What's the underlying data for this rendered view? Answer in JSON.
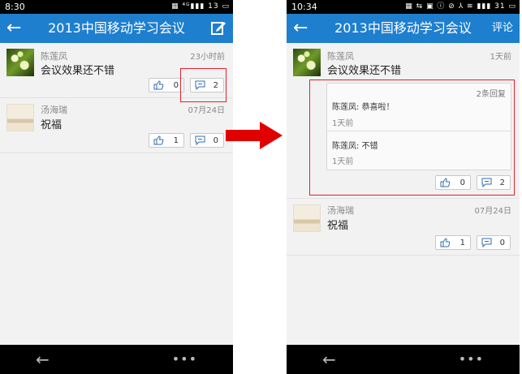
{
  "left_screen": {
    "status_time": "8:30",
    "status_icons": "▦ ⁴ᴳ▮▮▮ 13 ▭",
    "title": "2013中国移动学习会议",
    "posts": [
      {
        "author": "陈莲凤",
        "time": "23小时前",
        "text": "会议效果还不错",
        "likes": "0",
        "comments": "2"
      },
      {
        "author": "汤海瑞",
        "time": "07月24日",
        "text": "祝福",
        "likes": "1",
        "comments": "0"
      }
    ]
  },
  "right_screen": {
    "status_time": "10:34",
    "status_icons": "▦ ⇆ ▣ ⓘ ⊘ ⅄ ≋ ▮▮▮ 31 ▭",
    "title": "2013中国移动学习会议",
    "action_label": "评论",
    "posts": [
      {
        "author": "陈莲凤",
        "time": "1天前",
        "text": "会议效果还不错",
        "likes": "0",
        "comments": "2"
      },
      {
        "author": "汤海瑞",
        "time": "07月24日",
        "text": "祝福",
        "likes": "1",
        "comments": "0"
      }
    ],
    "replies": {
      "count_label": "2条回复",
      "items": [
        {
          "text": "陈莲凤: 恭喜啦！",
          "time": "1天前"
        },
        {
          "text": "陈莲凤: 不错",
          "time": "1天前"
        }
      ]
    }
  },
  "icons": {
    "back": "back-arrow-icon",
    "edit": "edit-icon",
    "like": "thumbs-up-icon",
    "comment": "comment-icon",
    "more": "more-dots-icon"
  },
  "colors": {
    "appbar": "#1e7fcf",
    "highlight": "#e4202a",
    "arrow": "#e00000"
  }
}
